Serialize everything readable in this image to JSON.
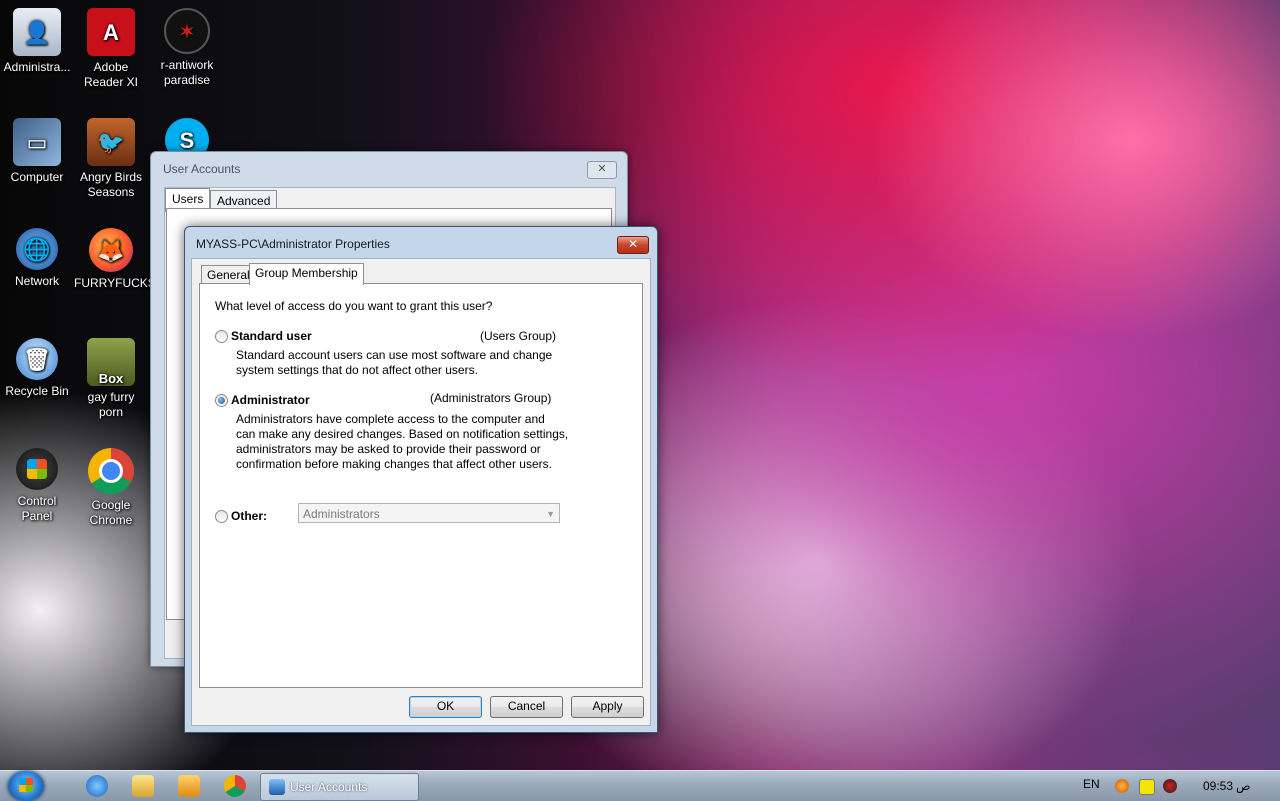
{
  "desktop": {
    "icons": [
      {
        "label": "Administra..."
      },
      {
        "label": "Adobe\nReader XI"
      },
      {
        "label": "r-antiwork\nparadise"
      },
      {
        "label": "Computer"
      },
      {
        "label": "Angry Birds\nSeasons"
      },
      {
        "label": "Network"
      },
      {
        "label": "FURRYFUCKS"
      },
      {
        "label": "Recycle Bin"
      },
      {
        "label": "gay furry\nporn"
      },
      {
        "label": "Control\nPanel"
      },
      {
        "label": "Google\nChrome"
      }
    ]
  },
  "ua_window": {
    "title": "User Accounts",
    "close_label": "✕",
    "tabs": [
      "Users",
      "Advanced"
    ]
  },
  "dialog": {
    "title": "MYASS-PC\\Administrator Properties",
    "close_label": "✕",
    "tabs": [
      "General",
      "Group Membership"
    ],
    "question": "What level of access do you want to grant this user?",
    "options": [
      {
        "label": "Standard user",
        "group": "(Users Group)",
        "description": "Standard account users can use most software and change\nsystem settings that do not affect other users.",
        "checked": false
      },
      {
        "label": "Administrator",
        "group": "(Administrators Group)",
        "description": "Administrators have complete access to the computer and\ncan make any desired changes. Based on notification settings,\nadministrators may be asked to provide their password or\nconfirmation before making changes that affect other users.",
        "checked": true
      },
      {
        "label": "Other:",
        "checked": false
      }
    ],
    "other_select_value": "Administrators",
    "buttons": {
      "ok": "OK",
      "cancel": "Cancel",
      "apply": "Apply"
    }
  },
  "taskbar": {
    "task_label": "User Accounts",
    "lang": "EN",
    "time": "09:53",
    "ampm": "ص"
  }
}
